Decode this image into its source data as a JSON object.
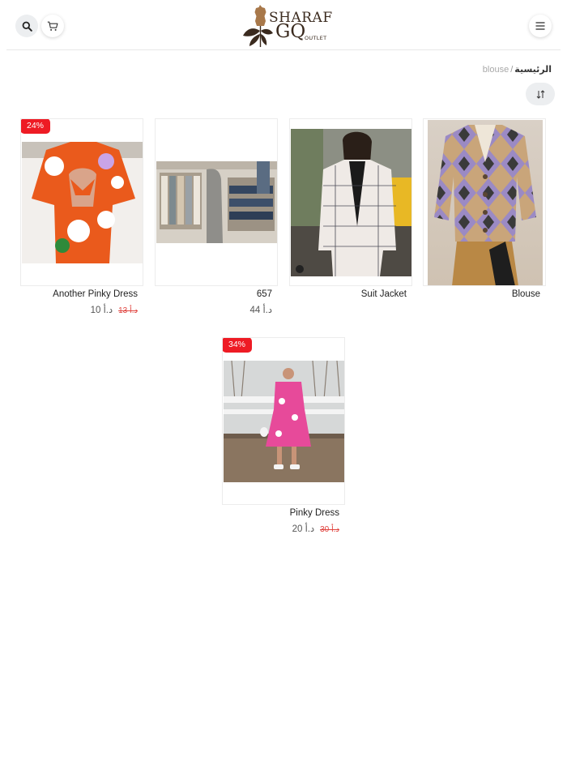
{
  "header": {
    "logo": {
      "line1": "SHARAF",
      "line2": "GQ",
      "line3": "OUTLET"
    },
    "icons": {
      "search": "search-icon",
      "cart": "cart-icon",
      "menu": "menu-icon"
    }
  },
  "breadcrumb": {
    "home": "الرئيسية",
    "separator": "/",
    "current": "blouse"
  },
  "sort": {
    "icon": "sort-icon"
  },
  "colors": {
    "badge": "#ee1b24",
    "old_price": "#e0443f",
    "button_bg": "#eceef0"
  },
  "products": [
    {
      "name": "Blouse",
      "price": "",
      "old_price": "",
      "badge": ""
    },
    {
      "name": "Suit Jacket",
      "price": "",
      "old_price": "",
      "badge": ""
    },
    {
      "name": "657",
      "price": "44 د.أ",
      "old_price": "",
      "badge": ""
    },
    {
      "name": "Another Pinky Dress",
      "price": "10 د.أ",
      "old_price": "13 د.أ",
      "badge": "24%"
    },
    {
      "name": "Pinky Dress",
      "price": "20 د.أ",
      "old_price": "30 د.أ",
      "badge": "34%"
    }
  ]
}
